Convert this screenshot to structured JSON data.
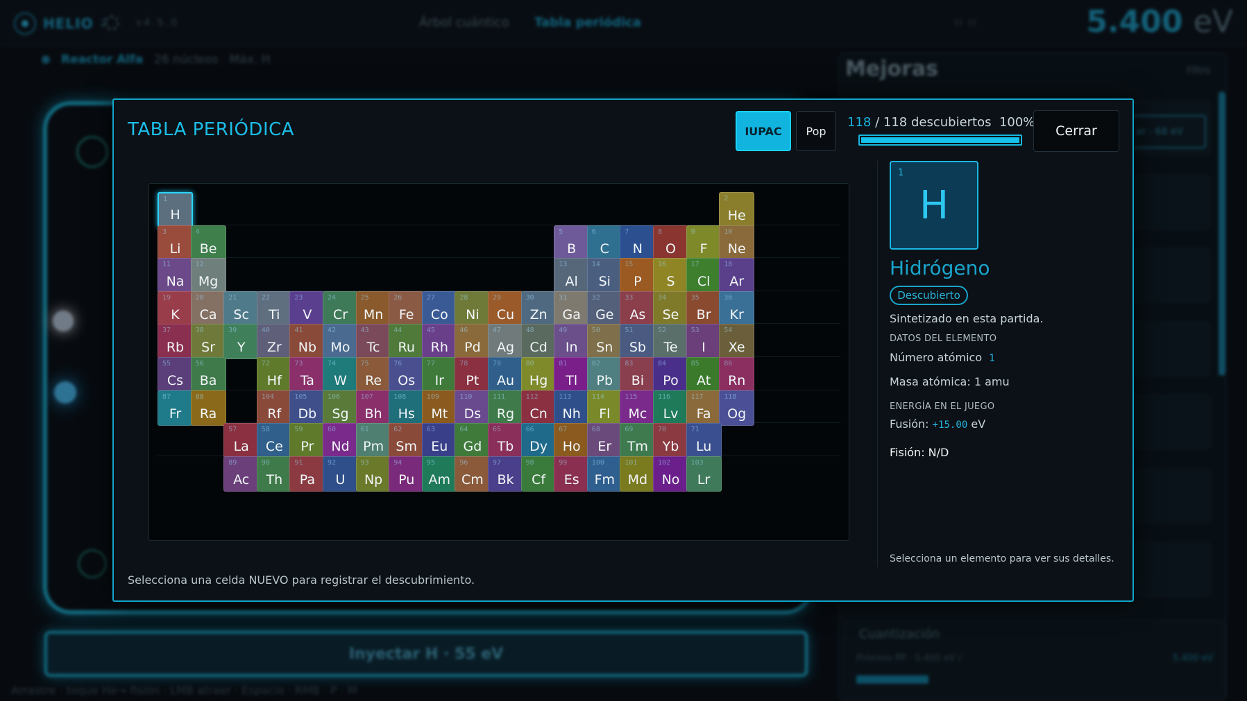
{
  "topbar": {
    "logo": "HELIO",
    "logo_suffix": "2",
    "version": "v4.5.0",
    "tabs": [
      "Árbol cuántico",
      "Tabla periódica"
    ],
    "mini": "II  II",
    "energy_value": "5.400",
    "energy_unit": "eV"
  },
  "reactor": {
    "name": "Reactor Alfa",
    "nuclei": "26 núcleos",
    "max": "Máx. H"
  },
  "inject_label": "Inyectar H · 55 eV",
  "controls_hint": "Arrastre · toque He→ fisión · LMB atraer · Espacio · RMB · P · M",
  "upgrades": {
    "title": "Mejoras",
    "filter": "Filtro",
    "buy_label": "ar · 68 eV",
    "quantization": {
      "title": "Cuantización",
      "subtitle": "Próximo PP · 5.400 eV /",
      "value": "5.400 eV"
    }
  },
  "modal": {
    "title": "TABLA PERIÓDICA",
    "btn_iupac": "IUPAC",
    "btn_pop": "Pop",
    "discovered_count": "118",
    "discovered_rest": "/ 118 descubiertos",
    "discovered_pct": "100%",
    "discovered_fraction": 1.0,
    "btn_close": "Cerrar",
    "status": "Selecciona una celda NUEVO para registrar el descubrimiento."
  },
  "detail": {
    "number": "1",
    "symbol": "H",
    "name": "Hidrógeno",
    "badge": "Descubierto",
    "synth": "Sintetizado en esta partida.",
    "data_header": "DATOS DEL ELEMENTO",
    "atomic_number_label": "Número atómico",
    "atomic_number_value": "1",
    "atomic_mass": "Masa atómica: 1 amu",
    "energy_header": "ENERGÍA EN EL JUEGO",
    "fusion_label": "Fusión:",
    "fusion_value": "+15.00",
    "fusion_unit": "eV",
    "fission": "Fisión: N/D",
    "hint": "Selecciona un elemento para ver sus detalles."
  },
  "elements": [
    {
      "n": 1,
      "s": "H",
      "c": "#5b6f7f"
    },
    {
      "n": 2,
      "s": "He",
      "c": "#8a7e2c"
    },
    {
      "n": 3,
      "s": "Li",
      "c": "#9a4c3c"
    },
    {
      "n": 4,
      "s": "Be",
      "c": "#3f7f4c"
    },
    {
      "n": 5,
      "s": "B",
      "c": "#6f5a99"
    },
    {
      "n": 6,
      "s": "C",
      "c": "#2f6f8f"
    },
    {
      "n": 7,
      "s": "N",
      "c": "#2b4f8f"
    },
    {
      "n": 8,
      "s": "O",
      "c": "#8a3530"
    },
    {
      "n": 9,
      "s": "F",
      "c": "#7e8a2a"
    },
    {
      "n": 10,
      "s": "Ne",
      "c": "#8a6a3a"
    },
    {
      "n": 11,
      "s": "Na",
      "c": "#6c4a8a"
    },
    {
      "n": 12,
      "s": "Mg",
      "c": "#6f7f7c"
    },
    {
      "n": 13,
      "s": "Al",
      "c": "#56677a"
    },
    {
      "n": 14,
      "s": "Si",
      "c": "#4a5f7f"
    },
    {
      "n": 15,
      "s": "P",
      "c": "#9a5a22"
    },
    {
      "n": 16,
      "s": "S",
      "c": "#8f8524"
    },
    {
      "n": 17,
      "s": "Cl",
      "c": "#3e7f2e"
    },
    {
      "n": 18,
      "s": "Ar",
      "c": "#5a3f8a"
    },
    {
      "n": 19,
      "s": "K",
      "c": "#9a3d4a"
    },
    {
      "n": 20,
      "s": "Ca",
      "c": "#857064"
    },
    {
      "n": 21,
      "s": "Sc",
      "c": "#4f7a8a"
    },
    {
      "n": 22,
      "s": "Ti",
      "c": "#5f6f80"
    },
    {
      "n": 23,
      "s": "V",
      "c": "#5a3f8f"
    },
    {
      "n": 24,
      "s": "Cr",
      "c": "#3e7a58"
    },
    {
      "n": 25,
      "s": "Mn",
      "c": "#8a5a2c"
    },
    {
      "n": 26,
      "s": "Fe",
      "c": "#8a5a44"
    },
    {
      "n": 27,
      "s": "Co",
      "c": "#3a5a96"
    },
    {
      "n": 28,
      "s": "Ni",
      "c": "#6f7a38"
    },
    {
      "n": 29,
      "s": "Cu",
      "c": "#9a5a2a"
    },
    {
      "n": 30,
      "s": "Zn",
      "c": "#4f6a80"
    },
    {
      "n": 31,
      "s": "Ga",
      "c": "#7f7a6f"
    },
    {
      "n": 32,
      "s": "Ge",
      "c": "#54607a"
    },
    {
      "n": 33,
      "s": "As",
      "c": "#8a3f4a"
    },
    {
      "n": 34,
      "s": "Se",
      "c": "#7f7a2a"
    },
    {
      "n": 35,
      "s": "Br",
      "c": "#8a4a30"
    },
    {
      "n": 36,
      "s": "Kr",
      "c": "#3a6f96"
    },
    {
      "n": 37,
      "s": "Rb",
      "c": "#8a2f4f"
    },
    {
      "n": 38,
      "s": "Sr",
      "c": "#6f7a3a"
    },
    {
      "n": 39,
      "s": "Y",
      "c": "#3f7f5a"
    },
    {
      "n": 40,
      "s": "Zr",
      "c": "#5f5f7a"
    },
    {
      "n": 41,
      "s": "Nb",
      "c": "#8a4a3a"
    },
    {
      "n": 42,
      "s": "Mo",
      "c": "#4a6a8f"
    },
    {
      "n": 43,
      "s": "Tc",
      "c": "#7a4a5a"
    },
    {
      "n": 44,
      "s": "Ru",
      "c": "#4f7a3a"
    },
    {
      "n": 45,
      "s": "Rh",
      "c": "#6a3f8a"
    },
    {
      "n": 46,
      "s": "Pd",
      "c": "#8a6a3a"
    },
    {
      "n": 47,
      "s": "Ag",
      "c": "#707a7a"
    },
    {
      "n": 48,
      "s": "Cd",
      "c": "#5a6a5f"
    },
    {
      "n": 49,
      "s": "In",
      "c": "#6a4f8a"
    },
    {
      "n": 50,
      "s": "Sn",
      "c": "#7f6f4a"
    },
    {
      "n": 51,
      "s": "Sb",
      "c": "#4a5a80"
    },
    {
      "n": 52,
      "s": "Te",
      "c": "#5a6f6a"
    },
    {
      "n": 53,
      "s": "I",
      "c": "#6a3f7a"
    },
    {
      "n": 54,
      "s": "Xe",
      "c": "#6a5f3a"
    },
    {
      "n": 55,
      "s": "Cs",
      "c": "#5a3f7a"
    },
    {
      "n": 56,
      "s": "Ba",
      "c": "#3f7a4a"
    },
    {
      "n": 72,
      "s": "Hf",
      "c": "#5f7a2a"
    },
    {
      "n": 73,
      "s": "Ta",
      "c": "#8a2f6a"
    },
    {
      "n": 74,
      "s": "W",
      "c": "#1f7a7a"
    },
    {
      "n": 75,
      "s": "Re",
      "c": "#8a5a3a"
    },
    {
      "n": 76,
      "s": "Os",
      "c": "#4a4f8f"
    },
    {
      "n": 77,
      "s": "Ir",
      "c": "#3f7a3a"
    },
    {
      "n": 78,
      "s": "Pt",
      "c": "#8a3040"
    },
    {
      "n": 79,
      "s": "Au",
      "c": "#2f5f8a"
    },
    {
      "n": 80,
      "s": "Hg",
      "c": "#7f8a2a"
    },
    {
      "n": 81,
      "s": "Tl",
      "c": "#7a1f8a"
    },
    {
      "n": 82,
      "s": "Pb",
      "c": "#4f7f80"
    },
    {
      "n": 83,
      "s": "Bi",
      "c": "#8a3f4f"
    },
    {
      "n": 84,
      "s": "Po",
      "c": "#4a2f8a"
    },
    {
      "n": 85,
      "s": "At",
      "c": "#3a7a2a"
    },
    {
      "n": 86,
      "s": "Rn",
      "c": "#8a2f60"
    },
    {
      "n": 87,
      "s": "Fr",
      "c": "#1f7a8a"
    },
    {
      "n": 88,
      "s": "Ra",
      "c": "#8a6a1a"
    },
    {
      "n": 104,
      "s": "Rf",
      "c": "#8a4a3a"
    },
    {
      "n": 105,
      "s": "Db",
      "c": "#3f4f8a"
    },
    {
      "n": 106,
      "s": "Sg",
      "c": "#5a7a3a"
    },
    {
      "n": 107,
      "s": "Bh",
      "c": "#8a2f6a"
    },
    {
      "n": 108,
      "s": "Hs",
      "c": "#1f6f7a"
    },
    {
      "n": 109,
      "s": "Mt",
      "c": "#8a5a1f"
    },
    {
      "n": 110,
      "s": "Ds",
      "c": "#6a4a8f"
    },
    {
      "n": 111,
      "s": "Rg",
      "c": "#3f7a4a"
    },
    {
      "n": 112,
      "s": "Cn",
      "c": "#8a3040"
    },
    {
      "n": 113,
      "s": "Nh",
      "c": "#2f4f8a"
    },
    {
      "n": 114,
      "s": "Fl",
      "c": "#7a8a2a"
    },
    {
      "n": 115,
      "s": "Mc",
      "c": "#7a2a8a"
    },
    {
      "n": 116,
      "s": "Lv",
      "c": "#1f7a5a"
    },
    {
      "n": 117,
      "s": "Fa",
      "c": "#8a6a3a"
    },
    {
      "n": 118,
      "s": "Og",
      "c": "#4a4f96"
    },
    {
      "n": 57,
      "s": "La",
      "c": "#8a3040"
    },
    {
      "n": 58,
      "s": "Ce",
      "c": "#2f5f8a"
    },
    {
      "n": 59,
      "s": "Pr",
      "c": "#5f7a2a"
    },
    {
      "n": 60,
      "s": "Nd",
      "c": "#7a2a8a"
    },
    {
      "n": 61,
      "s": "Pm",
      "c": "#4f7f70"
    },
    {
      "n": 62,
      "s": "Sm",
      "c": "#8a4a3a"
    },
    {
      "n": 63,
      "s": "Eu",
      "c": "#3a3f8a"
    },
    {
      "n": 64,
      "s": "Gd",
      "c": "#3f7a3a"
    },
    {
      "n": 65,
      "s": "Tb",
      "c": "#8a2f5a"
    },
    {
      "n": 66,
      "s": "Dy",
      "c": "#1f6a8a"
    },
    {
      "n": 67,
      "s": "Ho",
      "c": "#8a5a1f"
    },
    {
      "n": 68,
      "s": "Er",
      "c": "#6a4a7a"
    },
    {
      "n": 69,
      "s": "Tm",
      "c": "#3f7a4f"
    },
    {
      "n": 70,
      "s": "Yb",
      "c": "#8a3a40"
    },
    {
      "n": 71,
      "s": "Lu",
      "c": "#3a4f8f"
    },
    {
      "n": 89,
      "s": "Ac",
      "c": "#6a3f7a"
    },
    {
      "n": 90,
      "s": "Th",
      "c": "#3f7a4a"
    },
    {
      "n": 91,
      "s": "Pa",
      "c": "#8a3a40"
    },
    {
      "n": 92,
      "s": "U",
      "c": "#2f4f8a"
    },
    {
      "n": 93,
      "s": "Np",
      "c": "#6a7a2a"
    },
    {
      "n": 94,
      "s": "Pu",
      "c": "#7a2a7a"
    },
    {
      "n": 95,
      "s": "Am",
      "c": "#1f7a5a"
    },
    {
      "n": 96,
      "s": "Cm",
      "c": "#8a5a3a"
    },
    {
      "n": 97,
      "s": "Bk",
      "c": "#4a3f8a"
    },
    {
      "n": 98,
      "s": "Cf",
      "c": "#3a7a3a"
    },
    {
      "n": 99,
      "s": "Es",
      "c": "#8a2f4f"
    },
    {
      "n": 100,
      "s": "Fm",
      "c": "#2f5f8f"
    },
    {
      "n": 101,
      "s": "Md",
      "c": "#7a7a1f"
    },
    {
      "n": 102,
      "s": "No",
      "c": "#6a1f8a"
    },
    {
      "n": 103,
      "s": "Lr",
      "c": "#3f7a5a"
    }
  ],
  "selected_element": 1
}
